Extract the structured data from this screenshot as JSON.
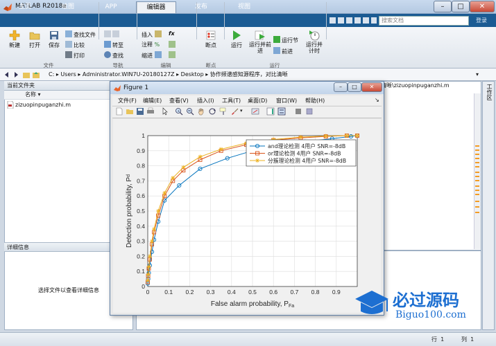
{
  "app": {
    "title": "MATLAB R2018a"
  },
  "window_buttons": {
    "minimize": "–",
    "maximize": "□",
    "close": "✕"
  },
  "tabs": [
    {
      "label": "主页",
      "active": false
    },
    {
      "label": "绘图",
      "active": false
    },
    {
      "label": "APP",
      "active": false
    },
    {
      "label": "编辑器",
      "active": true
    },
    {
      "label": "发布",
      "active": false
    },
    {
      "label": "视图",
      "active": false
    }
  ],
  "search": {
    "placeholder": "搜索文档"
  },
  "login": "登录",
  "ribbon": {
    "file": {
      "new": "新建",
      "open": "打开",
      "save": "保存",
      "find_files": "查找文件",
      "compare": "比较",
      "print": "打印",
      "group": "文件"
    },
    "nav": {
      "goto": "转至",
      "find": "查找",
      "group": "导航"
    },
    "edit": {
      "insert": "插入",
      "comment": "注释",
      "indent": "缩进",
      "fx": "fx",
      "group": "编辑"
    },
    "breakpoints": {
      "label": "断点",
      "group": "断点"
    },
    "run": {
      "run": "运行",
      "run_advance": "运行并前进",
      "run_section": "运行节",
      "advance": "前进",
      "run_time": "运行并计时",
      "group": "运行"
    }
  },
  "address": {
    "path": [
      "C:",
      "Users",
      "Administrator.WIN7U-20180127Z",
      "Desktop",
      "协作频谱感知源程序，对比清晰"
    ]
  },
  "left_pane": {
    "header": "当前文件夹",
    "column_name": "名称",
    "files": [
      "zizuopinpuganzhi.m"
    ],
    "details_header": "详细信息",
    "details_hint": "选择文件以查看详细信息"
  },
  "editor": {
    "tab_path": "清晰\\zizuopinpuganzhi.m"
  },
  "workspace": {
    "label": "工作区"
  },
  "status": {
    "row_label": "行",
    "row": "1",
    "col_label": "列",
    "col": "1"
  },
  "figure": {
    "title": "Figure 1",
    "menus": [
      "文件(F)",
      "编辑(E)",
      "查看(V)",
      "插入(I)",
      "工具(T)",
      "桌面(D)",
      "窗口(W)",
      "帮助(H)"
    ]
  },
  "colors": {
    "blue": "#0072bd",
    "orange": "#d95319",
    "yellow": "#edb120",
    "tabstrip": "#1b5b93"
  },
  "watermark": {
    "brand": "必过源码",
    "url": "Biguo100.com"
  },
  "chart_data": {
    "type": "line",
    "xlabel": "False alarm probability, P",
    "xlabel_sub": "Fa",
    "ylabel": "Detection probability, P",
    "ylabel_sub": "d",
    "xlim": [
      0,
      1
    ],
    "ylim": [
      0,
      1
    ],
    "xticks": [
      "0",
      "0.1",
      "0.2",
      "0.3",
      "0.4",
      "0.5",
      "0.6",
      "0.7",
      "0.8",
      "0.9"
    ],
    "yticks": [
      "0",
      "0.1",
      "0.2",
      "0.3",
      "0.4",
      "0.5",
      "0.6",
      "0.7",
      "0.8",
      "0.9",
      "1"
    ],
    "grid": true,
    "legend_position": "top-right",
    "series": [
      {
        "name": "and理论检测 4用户 SNR=-8dB",
        "marker": "circle",
        "color": "#0072bd",
        "x": [
          0.0,
          0.002,
          0.005,
          0.01,
          0.02,
          0.03,
          0.05,
          0.08,
          0.15,
          0.25,
          0.38,
          0.5,
          0.62,
          0.75,
          0.88,
          0.97,
          1.0
        ],
        "y": [
          0.02,
          0.05,
          0.09,
          0.14,
          0.23,
          0.31,
          0.43,
          0.57,
          0.67,
          0.78,
          0.85,
          0.9,
          0.93,
          0.96,
          0.98,
          0.995,
          1.0
        ]
      },
      {
        "name": "or理论检测 4用户 SNR=-8dB",
        "marker": "square",
        "color": "#d95319",
        "x": [
          0.0,
          0.002,
          0.005,
          0.01,
          0.02,
          0.03,
          0.05,
          0.08,
          0.12,
          0.17,
          0.25,
          0.35,
          0.47,
          0.6,
          0.73,
          0.85,
          0.95,
          1.0
        ],
        "y": [
          0.03,
          0.07,
          0.12,
          0.18,
          0.28,
          0.36,
          0.47,
          0.6,
          0.7,
          0.77,
          0.84,
          0.9,
          0.94,
          0.97,
          0.985,
          0.995,
          1.0,
          1.0
        ]
      },
      {
        "name": "分簇理论检测 4用户 SNR=-8dB",
        "marker": "star",
        "color": "#edb120",
        "x": [
          0.0,
          0.002,
          0.005,
          0.01,
          0.02,
          0.03,
          0.05,
          0.08,
          0.12,
          0.17,
          0.25,
          0.35,
          0.47,
          0.6,
          0.73,
          0.85,
          0.95,
          1.0
        ],
        "y": [
          0.04,
          0.08,
          0.13,
          0.2,
          0.3,
          0.38,
          0.5,
          0.62,
          0.72,
          0.79,
          0.86,
          0.91,
          0.95,
          0.975,
          0.99,
          0.997,
          1.0,
          1.0
        ]
      }
    ]
  }
}
